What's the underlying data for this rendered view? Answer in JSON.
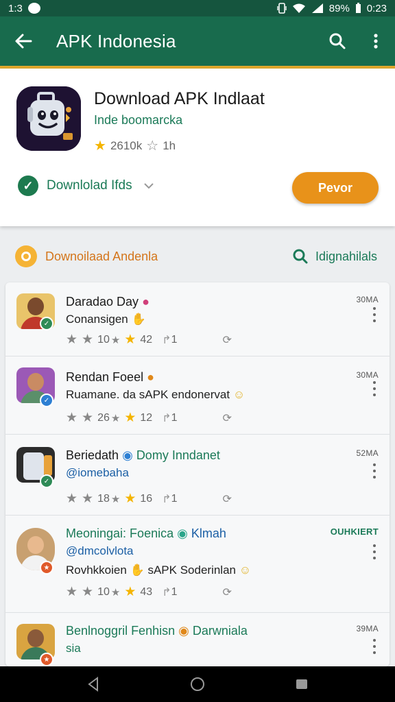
{
  "status_bar": {
    "time_left": "1:3",
    "battery": "89%",
    "clock": "0:23"
  },
  "app_bar": {
    "title": "APK Indonesia"
  },
  "app_header": {
    "name": "Download APK Indlaat",
    "developer": "Inde boomarcka",
    "rating": "2610k",
    "rating_secondary": "1h",
    "download_status": "Downlolad Ifds",
    "primary_button": "Pevor"
  },
  "section": {
    "left_label": "Downoilaad Andenla",
    "right_label": "Idignahilals"
  },
  "items": [
    {
      "name": "Daradao Day",
      "text": "Conansigen",
      "stat1": "10",
      "stat2": "42",
      "stat3": "1",
      "time": "30MA"
    },
    {
      "name": "Rendan Foeel",
      "text": "Ruamane. da sAPK endonervat",
      "stat1": "26",
      "stat2": "12",
      "stat3": "1",
      "time": "30MA"
    },
    {
      "name": "Beriedath",
      "tag": "Domy Inndanet",
      "handle": "@iomebaha",
      "stat1": "18",
      "stat2": "16",
      "stat3": "1",
      "time": "52MA"
    },
    {
      "name": "Meoningai: Foenica",
      "tag": "Klmah",
      "handle": "@dmcolvlota",
      "text": "Rovhkkoien",
      "text2": "sAPK Soderinlan",
      "stat1": "10",
      "stat2": "43",
      "stat3": "1",
      "time": "OUHKIERT"
    },
    {
      "name": "Benlnoggril Fenhisn",
      "tag": "Darwniala",
      "handle": "sia",
      "time": "39MA"
    }
  ]
}
